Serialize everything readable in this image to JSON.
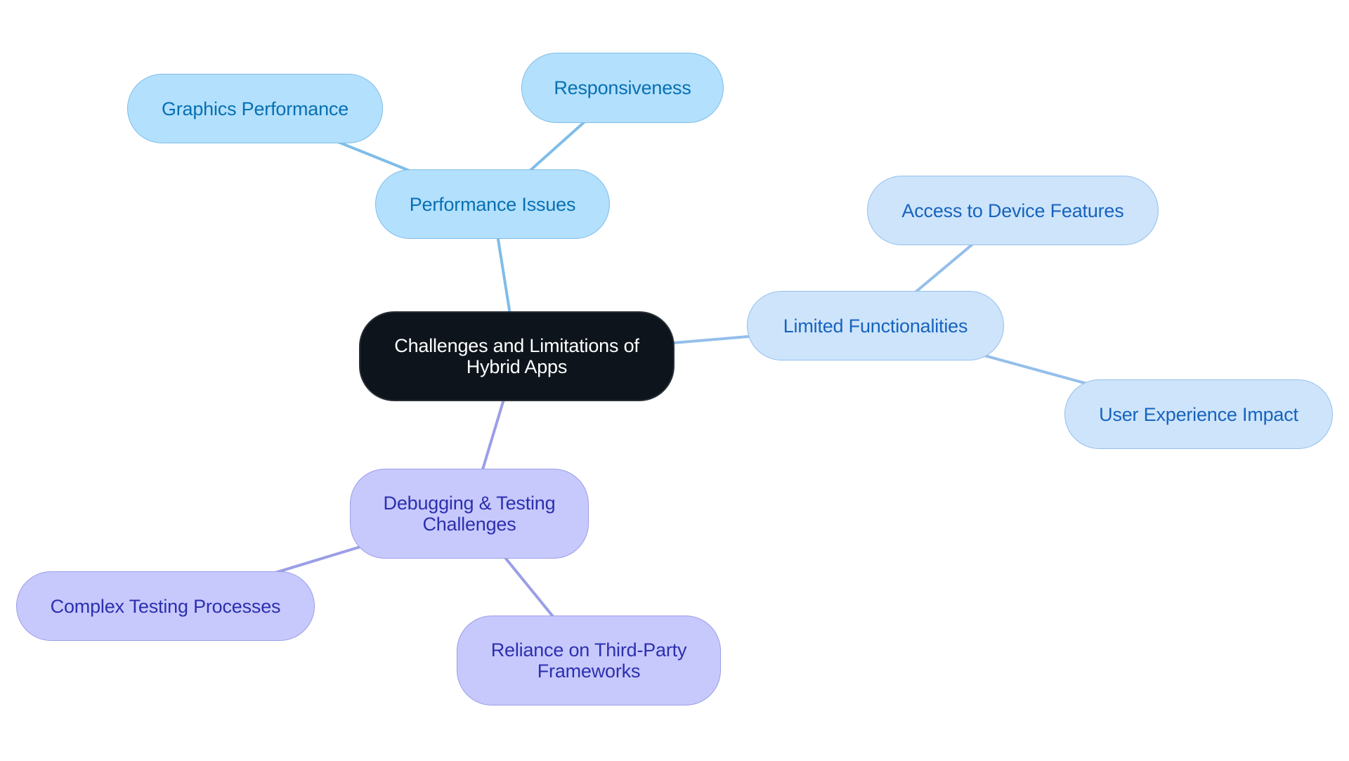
{
  "diagram": {
    "type": "mind-map",
    "root": {
      "id": "root",
      "label": "Challenges and Limitations of\nHybrid Apps"
    },
    "nodes": [
      {
        "id": "perf",
        "label": "Performance Issues",
        "parent": "root",
        "group": "perf"
      },
      {
        "id": "graphics",
        "label": "Graphics Performance",
        "parent": "perf",
        "group": "perf"
      },
      {
        "id": "resp",
        "label": "Responsiveness",
        "parent": "perf",
        "group": "perf"
      },
      {
        "id": "func",
        "label": "Limited Functionalities",
        "parent": "root",
        "group": "func"
      },
      {
        "id": "device",
        "label": "Access to Device Features",
        "parent": "func",
        "group": "func"
      },
      {
        "id": "ux",
        "label": "User Experience Impact",
        "parent": "func",
        "group": "func"
      },
      {
        "id": "debug",
        "label": "Debugging & Testing\nChallenges",
        "parent": "root",
        "group": "debug"
      },
      {
        "id": "complex",
        "label": "Complex Testing Processes",
        "parent": "debug",
        "group": "debug"
      },
      {
        "id": "reliance",
        "label": "Reliance on Third-Party\nFrameworks",
        "parent": "debug",
        "group": "debug"
      }
    ],
    "colors": {
      "root_fill": "#0d141c",
      "perf_fill": "#b3e0fd",
      "perf_text": "#0770b2",
      "perf_edge": "#7fbde8",
      "func_fill": "#cde4fb",
      "func_text": "#1763bd",
      "func_edge": "#94bfeb",
      "debug_fill": "#c7c9fd",
      "debug_text": "#2d2fae",
      "debug_edge": "#9b9ee6"
    }
  }
}
